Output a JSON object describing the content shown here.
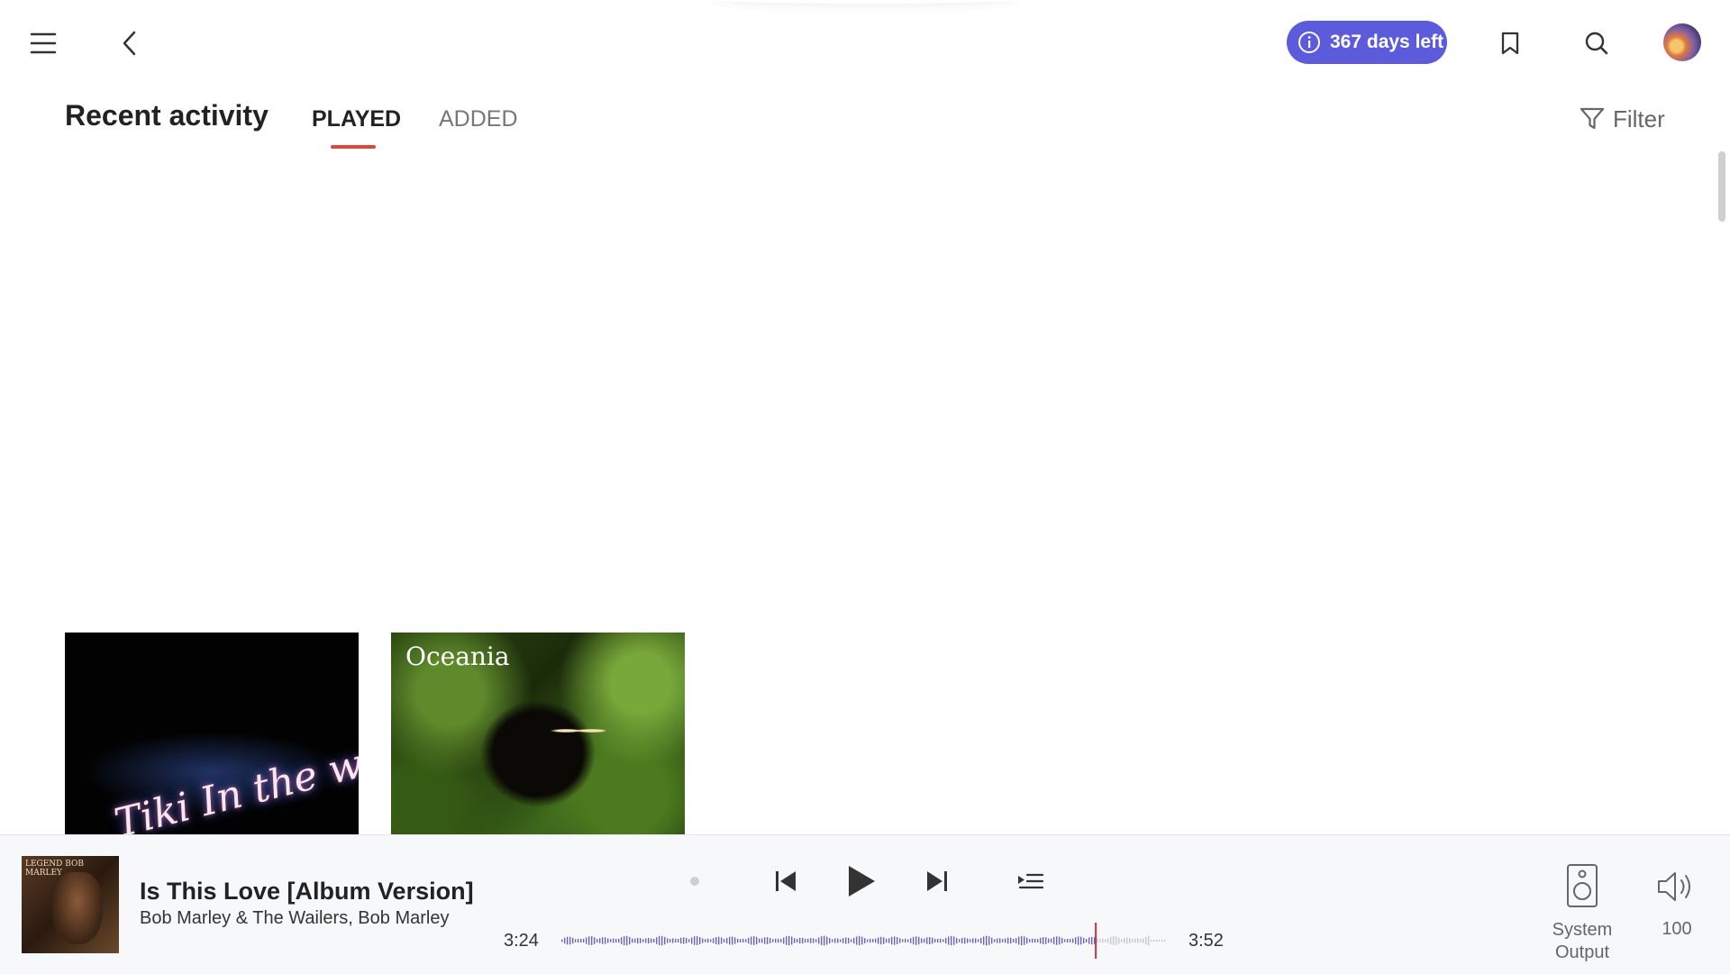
{
  "header": {
    "trial_badge": "367 days left",
    "icons": {
      "menu": "hamburger-menu-icon",
      "back": "chevron-left-icon",
      "info": "info-icon",
      "bookmark": "bookmark-icon",
      "search": "search-icon",
      "avatar": "avatar"
    },
    "accent_color": "#5b5bdc"
  },
  "page": {
    "title": "Recent activity",
    "tabs": [
      {
        "label": "PLAYED",
        "active": true
      },
      {
        "label": "ADDED",
        "active": false
      }
    ],
    "tab_indicator_color": "#e0453a",
    "filter_label": "Filter"
  },
  "albums": [
    {
      "cover_text": "Tiki In the world of Light"
    },
    {
      "cover_text": "Oceania"
    }
  ],
  "player": {
    "cover_text": "LEGEND BOB MARLEY",
    "title": "Is This Love [Album Version]",
    "artist": "Bob Marley & The Wailers, Bob Marley",
    "elapsed": "3:24",
    "total": "3:52",
    "progress_fraction": 0.88,
    "output_label_line1": "System",
    "output_label_line2": "Output",
    "volume": "100",
    "waveform_played_color": "#6b63c4",
    "waveform_remaining_color": "#c8c8c8",
    "playhead_color": "#c0394b"
  }
}
